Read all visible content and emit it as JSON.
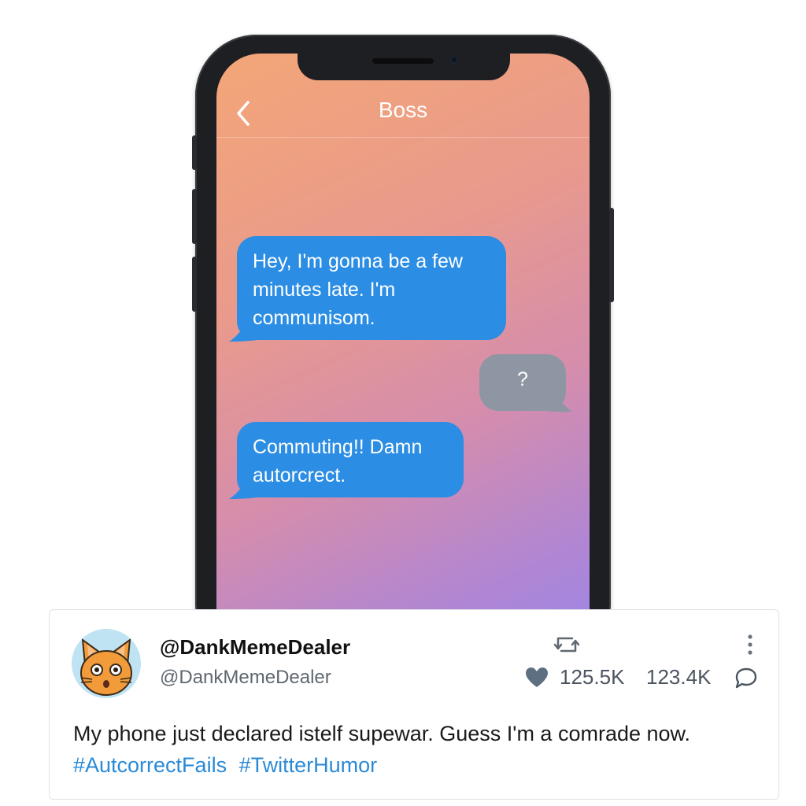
{
  "chat": {
    "contact_name": "Boss",
    "messages": [
      {
        "direction": "incoming",
        "text": "Hey, I'm gonna be a few minutes late. I'm communisom."
      },
      {
        "direction": "outgoing",
        "text": "?"
      },
      {
        "direction": "incoming",
        "text": "Commuting!! Damn autorcrect."
      }
    ]
  },
  "tweet": {
    "display_name": "@DankMemeDealer",
    "handle": "@DankMemeDealer",
    "likes": "125.5K",
    "retweets": "123.4K",
    "text": "My phone just declared istelf supewar. Guess I'm a comrade now.",
    "hashtags": [
      "#AutcorrectFails",
      "#TwitterHumor"
    ]
  },
  "icons": {
    "back": "chevron-left-icon",
    "retweet": "retweet-icon",
    "more": "more-vertical-icon",
    "like": "heart-icon",
    "reply": "reply-icon",
    "avatar": "cat-avatar"
  },
  "colors": {
    "incoming_bubble": "#2b8de3",
    "outgoing_bubble": "#8e96a3",
    "hashtag": "#2a8ad6"
  }
}
